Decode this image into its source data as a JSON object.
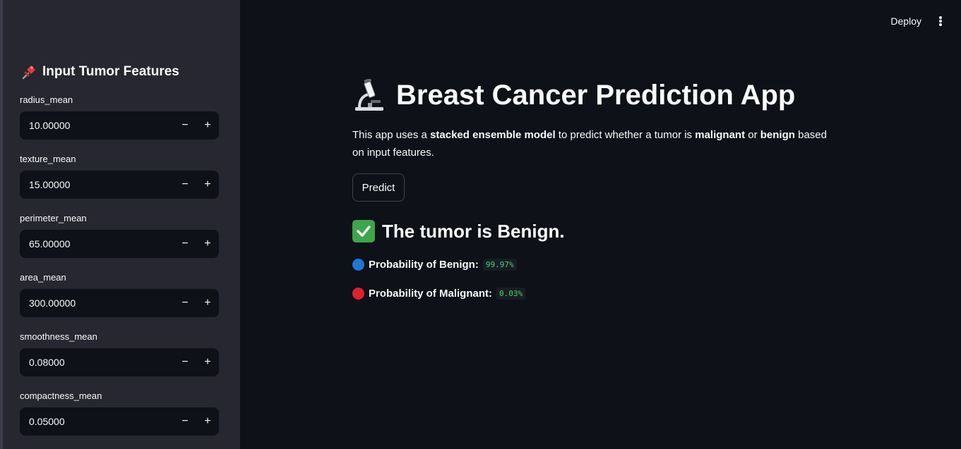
{
  "toolbar": {
    "deploy_label": "Deploy",
    "menu_icon": "kebab-menu-icon"
  },
  "sidebar": {
    "title": "Input Tumor Features",
    "title_icon": "pushpin-icon",
    "fields": [
      {
        "label": "radius_mean",
        "value": "10.00000"
      },
      {
        "label": "texture_mean",
        "value": "15.00000"
      },
      {
        "label": "perimeter_mean",
        "value": "65.00000"
      },
      {
        "label": "area_mean",
        "value": "300.00000"
      },
      {
        "label": "smoothness_mean",
        "value": "0.08000"
      },
      {
        "label": "compactness_mean",
        "value": "0.05000"
      }
    ],
    "minus_label": "−",
    "plus_label": "+"
  },
  "main": {
    "title": "Breast Cancer Prediction App",
    "title_icon": "microscope-icon",
    "description": {
      "p1": "This app uses a ",
      "b1": "stacked ensemble model",
      "p2": " to predict whether a tumor is ",
      "b2": "malignant",
      "p3": " or ",
      "b3": "benign",
      "p4": " based on input features."
    },
    "predict_label": "Predict",
    "result_text": "The tumor is Benign.",
    "result_icon": "check-mark-icon",
    "prob_benign_label": "Probability of Benign:",
    "prob_benign_value": "99.97%",
    "prob_malignant_label": "Probability of Malignant:",
    "prob_malignant_value": "0.03%",
    "colors": {
      "benign_dot": "#1f77d4",
      "malignant_dot": "#e0202a",
      "value_green": "#3dd56d"
    }
  }
}
